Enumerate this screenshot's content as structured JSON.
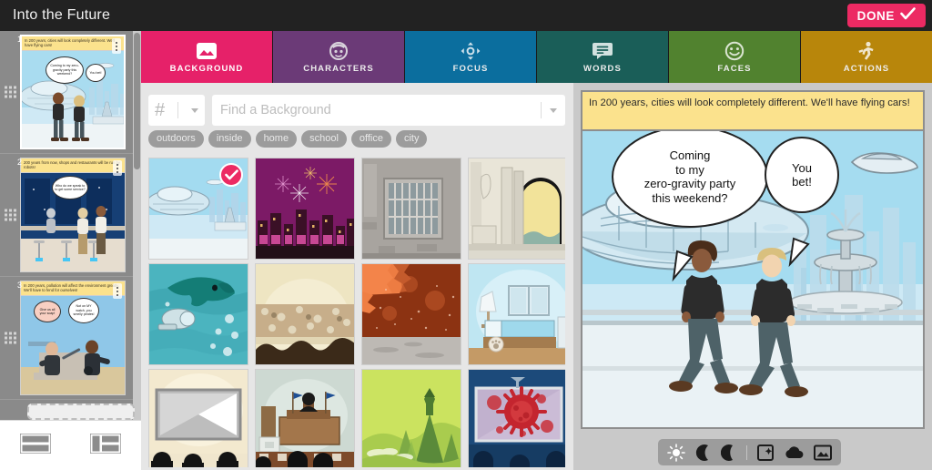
{
  "header": {
    "title": "Into the Future",
    "done_label": "DONE",
    "done_icon": "check-icon",
    "bg": "#222222",
    "done_color": "#ec2a63"
  },
  "tabs": [
    {
      "label": "BACKGROUND",
      "icon": "image-icon",
      "color": "#e62169",
      "active": true
    },
    {
      "label": "CHARACTERS",
      "icon": "person-icon",
      "color": "#6b3a77",
      "active": false
    },
    {
      "label": "FOCUS",
      "icon": "move-icon",
      "color": "#0b6e9e",
      "active": false
    },
    {
      "label": "WORDS",
      "icon": "speech-icon",
      "color": "#1a5e58",
      "active": false
    },
    {
      "label": "FACES",
      "icon": "smiley-icon",
      "color": "#51822f",
      "active": false
    },
    {
      "label": "ACTIONS",
      "icon": "runner-icon",
      "color": "#b8860b",
      "active": false
    }
  ],
  "search": {
    "hash_symbol": "#",
    "placeholder": "Find a Background",
    "value": "",
    "chips": [
      "outdoors",
      "inside",
      "home",
      "school",
      "office",
      "city"
    ]
  },
  "backgrounds": [
    {
      "name": "futuristic-city-plaza",
      "selected": true,
      "kind": "futuristic"
    },
    {
      "name": "fireworks-city-night",
      "selected": false,
      "kind": "fireworks"
    },
    {
      "name": "prison-cell-window",
      "selected": false,
      "kind": "prison"
    },
    {
      "name": "ancient-temple-arch",
      "selected": false,
      "kind": "temple"
    },
    {
      "name": "underwater-whale",
      "selected": false,
      "kind": "ocean"
    },
    {
      "name": "desert-cave-dunes",
      "selected": false,
      "kind": "cave"
    },
    {
      "name": "mars-red-cliff",
      "selected": false,
      "kind": "mars"
    },
    {
      "name": "bedroom-interior",
      "selected": false,
      "kind": "bedroom"
    },
    {
      "name": "movie-theater-screen",
      "selected": false,
      "kind": "cinema"
    },
    {
      "name": "courtroom-bench",
      "selected": false,
      "kind": "courtroom"
    },
    {
      "name": "green-hills-tower",
      "selected": false,
      "kind": "hills"
    },
    {
      "name": "virus-projection",
      "selected": false,
      "kind": "virus"
    }
  ],
  "panels": [
    {
      "number": "1",
      "caption": "In 200 years, cities will look completely different. We'll have flying cars!",
      "bubbles": [
        "Coming to my zero-gravity party this weekend?",
        "You bet!"
      ],
      "selected": true
    },
    {
      "number": "2",
      "caption": "200 years from now, shops and restaurants will be run by robots!",
      "bubbles": [
        "Who do we speak to to get some service?"
      ],
      "selected": false
    },
    {
      "number": "3",
      "caption": "In 200 years, pollution will affect the environment greatly. We'll have to fend for ourselves!",
      "bubbles": [
        "Give us all your soap!",
        "Not on MY watch, you smelly pirates!"
      ],
      "selected": false
    }
  ],
  "stage": {
    "caption": "In 200 years, cities will look completely different. We'll have flying cars!",
    "bubble_main_lines": [
      "Coming",
      "to my",
      "zero-gravity party",
      "this weekend?"
    ],
    "bubble_second_lines": [
      "You",
      "bet!"
    ],
    "toolbar": [
      {
        "name": "sun-icon",
        "title": "day"
      },
      {
        "name": "moon-icon",
        "title": "night"
      },
      {
        "name": "crescent-icon",
        "title": "dusk"
      },
      {
        "name": "add-scene-icon",
        "title": "new scene"
      },
      {
        "name": "cloud-icon",
        "title": "weather"
      },
      {
        "name": "image-icon",
        "title": "image"
      }
    ]
  },
  "layout_bar": {
    "buttons": [
      {
        "name": "layout-rows-button"
      },
      {
        "name": "layout-mixed-button"
      }
    ]
  }
}
